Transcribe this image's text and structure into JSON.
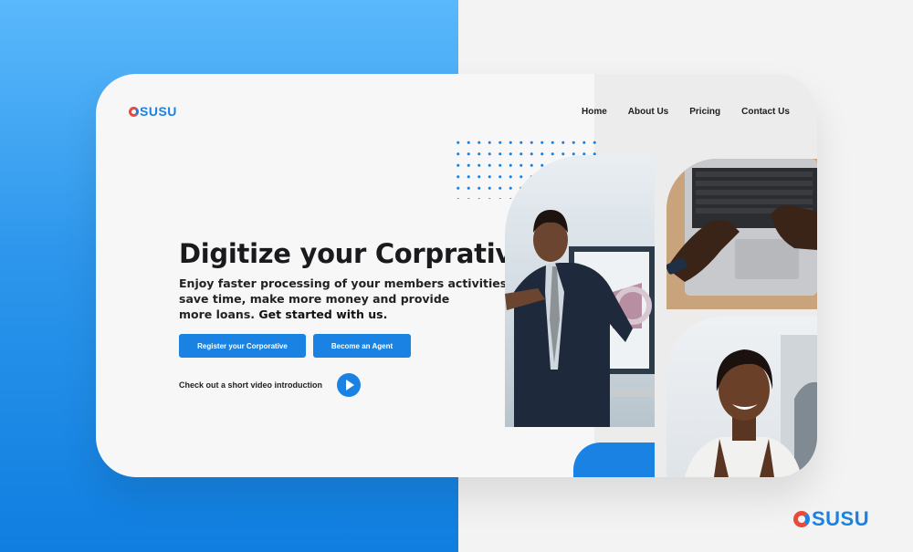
{
  "brand": {
    "name": "SUSU",
    "accent": "#1a82e2",
    "mark_accent": "#e84b3b"
  },
  "nav": {
    "items": [
      "Home",
      "About Us",
      "Pricing",
      "Contact Us"
    ]
  },
  "hero": {
    "title": "Digitize your Corprative",
    "subtitle_lines": [
      "Enjoy faster processing of your members activities,",
      " save time, make more money and provide",
      "more loans. "
    ],
    "subtitle_cta": "Get started with us.",
    "buttons": {
      "register": "Register your Corporative",
      "agent": "Become an Agent"
    },
    "video_text": "Check out a short video introduction"
  },
  "icons": {
    "play": "play-icon",
    "logo_mark": "logo-mark-icon"
  }
}
